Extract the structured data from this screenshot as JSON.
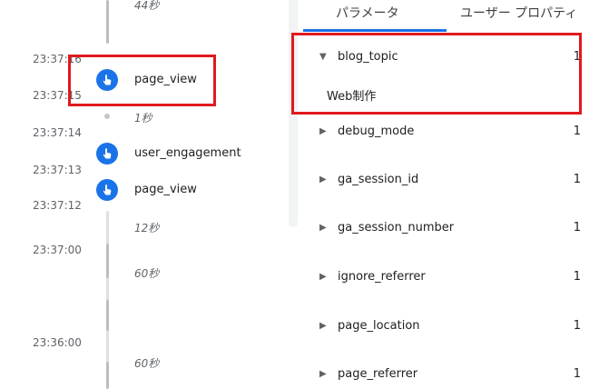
{
  "timeline": {
    "top_gap": "44秒",
    "times": [
      "23:37:16",
      "23:37:15",
      "23:37:14",
      "23:37:13",
      "23:37:12",
      "23:37:00",
      "23:36:00"
    ],
    "events": [
      {
        "label": "page_view"
      },
      {
        "label": "user_engagement"
      },
      {
        "label": "page_view"
      }
    ],
    "gaps": [
      "1秒",
      "12秒",
      "60秒",
      "60秒"
    ]
  },
  "tabs": [
    {
      "label": "パラメータ",
      "active": true
    },
    {
      "label": "ユーザー プロパティ",
      "active": false
    }
  ],
  "parameters": [
    {
      "name": "blog_topic",
      "count": "1",
      "expanded": true,
      "value": "Web制作"
    },
    {
      "name": "debug_mode",
      "count": "1",
      "expanded": false
    },
    {
      "name": "ga_session_id",
      "count": "1",
      "expanded": false
    },
    {
      "name": "ga_session_number",
      "count": "1",
      "expanded": false
    },
    {
      "name": "ignore_referrer",
      "count": "1",
      "expanded": false
    },
    {
      "name": "page_location",
      "count": "1",
      "expanded": false
    },
    {
      "name": "page_referrer",
      "count": "1",
      "expanded": false
    }
  ],
  "colors": {
    "accent": "#1a73e8",
    "highlight": "#e0191e",
    "timeline": "#bdbdbd"
  },
  "icons": {
    "event": "touch-hand-icon",
    "collapsed": "caret-right-icon",
    "expanded": "caret-down-icon"
  }
}
